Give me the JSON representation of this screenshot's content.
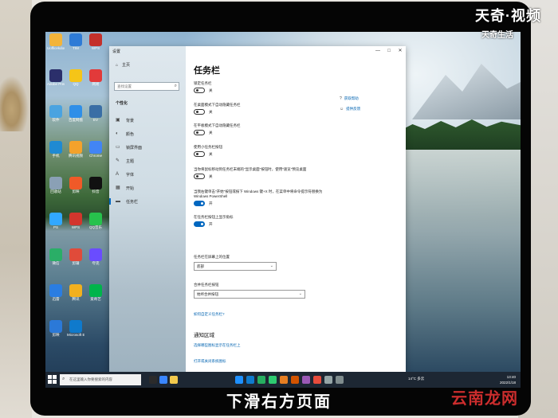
{
  "watermarks": {
    "top_brand": "天奇·视频",
    "top_sub": "天奇生活",
    "caption": "下滑右方页面",
    "bottom_brand": "云南龙网"
  },
  "settings_window": {
    "title": "设置",
    "controls": {
      "minimize": "—",
      "maximize": "□",
      "close": "✕"
    },
    "nav": {
      "home": "主页",
      "search_placeholder": "查找设置",
      "section": "个性化",
      "items": [
        "背景",
        "颜色",
        "锁屏界面",
        "主题",
        "字体",
        "开始",
        "任务栏"
      ],
      "active_index": 6
    },
    "page_title": "任务栏",
    "settings": [
      {
        "label": "锁定任务栏",
        "state": "关",
        "on": false
      },
      {
        "label": "在桌面模式下自动隐藏任务栏",
        "state": "关",
        "on": false
      },
      {
        "label": "在平板模式下自动隐藏任务栏",
        "state": "关",
        "on": false
      },
      {
        "label": "使用小任务栏按钮",
        "state": "关",
        "on": false
      },
      {
        "label": "当你将鼠标移动到任务栏末端的\"显示桌面\"按钮时，使用\"速览\"预览桌面",
        "state": "关",
        "on": false
      },
      {
        "label": "当我右键单击\"开始\"按钮或按下 Windows 键+X 时，在菜单中将命令提示符替换为 Windows PowerShell",
        "state": "开",
        "on": true
      },
      {
        "label": "在任务栏按钮上显示角标",
        "state": "开",
        "on": true
      }
    ],
    "position": {
      "label": "任务栏在屏幕上的位置",
      "value": "底部"
    },
    "combine": {
      "label": "合并任务栏按钮",
      "value": "始终合并按钮"
    },
    "link_customize": "如何自定义任务栏?",
    "notification_heading": "通知区域",
    "link_select_icons": "选择哪些图标显示在任务栏上",
    "link_system_icons": "打开或关闭系统图标",
    "help": {
      "get_help": "获取帮助",
      "feedback": "提供反馈"
    }
  },
  "taskbar": {
    "search_placeholder": "在这里输入你要搜索的内容",
    "weather": "14°C 多云",
    "time": "13:40",
    "date": "2022/1/18"
  },
  "desktop_icons": [
    "Uofficekdown",
    "TIM",
    "WPS",
    "Adobe Premie..",
    "QQ",
    "网易",
    "软件",
    "百度网盘",
    "EV",
    "手机",
    "腾讯视频",
    "Chrome",
    "回收站",
    "剪映",
    "抖音",
    "PS",
    "WPS",
    "QQ音乐",
    "微信",
    "剪辑",
    "夸克",
    "迅雷",
    "腾讯",
    "爱奇艺",
    "剪映",
    "Microsoft Edge"
  ],
  "colors": {
    "accent": "#0067c0",
    "link": "#0063b1",
    "taskbar": "#1d2733"
  }
}
